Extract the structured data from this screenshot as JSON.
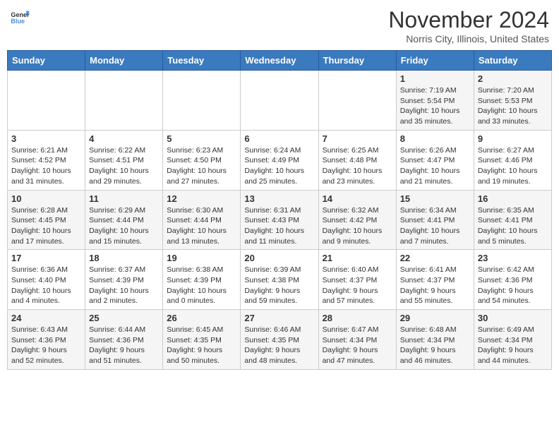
{
  "header": {
    "logo_line1": "General",
    "logo_line2": "Blue",
    "month": "November 2024",
    "location": "Norris City, Illinois, United States"
  },
  "weekdays": [
    "Sunday",
    "Monday",
    "Tuesday",
    "Wednesday",
    "Thursday",
    "Friday",
    "Saturday"
  ],
  "weeks": [
    [
      {
        "day": "",
        "info": ""
      },
      {
        "day": "",
        "info": ""
      },
      {
        "day": "",
        "info": ""
      },
      {
        "day": "",
        "info": ""
      },
      {
        "day": "",
        "info": ""
      },
      {
        "day": "1",
        "info": "Sunrise: 7:19 AM\nSunset: 5:54 PM\nDaylight: 10 hours\nand 35 minutes."
      },
      {
        "day": "2",
        "info": "Sunrise: 7:20 AM\nSunset: 5:53 PM\nDaylight: 10 hours\nand 33 minutes."
      }
    ],
    [
      {
        "day": "3",
        "info": "Sunrise: 6:21 AM\nSunset: 4:52 PM\nDaylight: 10 hours\nand 31 minutes."
      },
      {
        "day": "4",
        "info": "Sunrise: 6:22 AM\nSunset: 4:51 PM\nDaylight: 10 hours\nand 29 minutes."
      },
      {
        "day": "5",
        "info": "Sunrise: 6:23 AM\nSunset: 4:50 PM\nDaylight: 10 hours\nand 27 minutes."
      },
      {
        "day": "6",
        "info": "Sunrise: 6:24 AM\nSunset: 4:49 PM\nDaylight: 10 hours\nand 25 minutes."
      },
      {
        "day": "7",
        "info": "Sunrise: 6:25 AM\nSunset: 4:48 PM\nDaylight: 10 hours\nand 23 minutes."
      },
      {
        "day": "8",
        "info": "Sunrise: 6:26 AM\nSunset: 4:47 PM\nDaylight: 10 hours\nand 21 minutes."
      },
      {
        "day": "9",
        "info": "Sunrise: 6:27 AM\nSunset: 4:46 PM\nDaylight: 10 hours\nand 19 minutes."
      }
    ],
    [
      {
        "day": "10",
        "info": "Sunrise: 6:28 AM\nSunset: 4:45 PM\nDaylight: 10 hours\nand 17 minutes."
      },
      {
        "day": "11",
        "info": "Sunrise: 6:29 AM\nSunset: 4:44 PM\nDaylight: 10 hours\nand 15 minutes."
      },
      {
        "day": "12",
        "info": "Sunrise: 6:30 AM\nSunset: 4:44 PM\nDaylight: 10 hours\nand 13 minutes."
      },
      {
        "day": "13",
        "info": "Sunrise: 6:31 AM\nSunset: 4:43 PM\nDaylight: 10 hours\nand 11 minutes."
      },
      {
        "day": "14",
        "info": "Sunrise: 6:32 AM\nSunset: 4:42 PM\nDaylight: 10 hours\nand 9 minutes."
      },
      {
        "day": "15",
        "info": "Sunrise: 6:34 AM\nSunset: 4:41 PM\nDaylight: 10 hours\nand 7 minutes."
      },
      {
        "day": "16",
        "info": "Sunrise: 6:35 AM\nSunset: 4:41 PM\nDaylight: 10 hours\nand 5 minutes."
      }
    ],
    [
      {
        "day": "17",
        "info": "Sunrise: 6:36 AM\nSunset: 4:40 PM\nDaylight: 10 hours\nand 4 minutes."
      },
      {
        "day": "18",
        "info": "Sunrise: 6:37 AM\nSunset: 4:39 PM\nDaylight: 10 hours\nand 2 minutes."
      },
      {
        "day": "19",
        "info": "Sunrise: 6:38 AM\nSunset: 4:39 PM\nDaylight: 10 hours\nand 0 minutes."
      },
      {
        "day": "20",
        "info": "Sunrise: 6:39 AM\nSunset: 4:38 PM\nDaylight: 9 hours\nand 59 minutes."
      },
      {
        "day": "21",
        "info": "Sunrise: 6:40 AM\nSunset: 4:37 PM\nDaylight: 9 hours\nand 57 minutes."
      },
      {
        "day": "22",
        "info": "Sunrise: 6:41 AM\nSunset: 4:37 PM\nDaylight: 9 hours\nand 55 minutes."
      },
      {
        "day": "23",
        "info": "Sunrise: 6:42 AM\nSunset: 4:36 PM\nDaylight: 9 hours\nand 54 minutes."
      }
    ],
    [
      {
        "day": "24",
        "info": "Sunrise: 6:43 AM\nSunset: 4:36 PM\nDaylight: 9 hours\nand 52 minutes."
      },
      {
        "day": "25",
        "info": "Sunrise: 6:44 AM\nSunset: 4:36 PM\nDaylight: 9 hours\nand 51 minutes."
      },
      {
        "day": "26",
        "info": "Sunrise: 6:45 AM\nSunset: 4:35 PM\nDaylight: 9 hours\nand 50 minutes."
      },
      {
        "day": "27",
        "info": "Sunrise: 6:46 AM\nSunset: 4:35 PM\nDaylight: 9 hours\nand 48 minutes."
      },
      {
        "day": "28",
        "info": "Sunrise: 6:47 AM\nSunset: 4:34 PM\nDaylight: 9 hours\nand 47 minutes."
      },
      {
        "day": "29",
        "info": "Sunrise: 6:48 AM\nSunset: 4:34 PM\nDaylight: 9 hours\nand 46 minutes."
      },
      {
        "day": "30",
        "info": "Sunrise: 6:49 AM\nSunset: 4:34 PM\nDaylight: 9 hours\nand 44 minutes."
      }
    ]
  ]
}
